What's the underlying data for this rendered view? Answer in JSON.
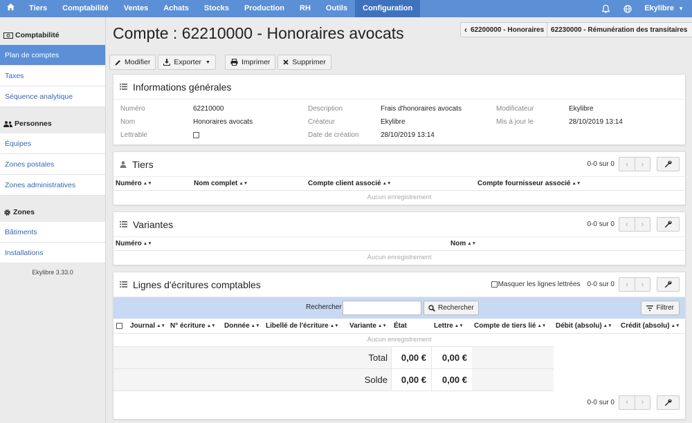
{
  "topnav": {
    "items": [
      "Tiers",
      "Comptabilité",
      "Ventes",
      "Achats",
      "Stocks",
      "Production",
      "RH",
      "Outils",
      "Configuration"
    ],
    "active": "Configuration",
    "user": "Ekylibre",
    "icons": [
      "home-icon",
      "bell-icon",
      "globe-icon",
      "caret-down-icon"
    ]
  },
  "sidebar": {
    "sections": [
      {
        "title": "Comptabilité",
        "icon": "money-icon",
        "items": [
          "Plan de comptes",
          "Taxes",
          "Séquence analytique"
        ]
      },
      {
        "title": "Personnes",
        "icon": "users-icon",
        "items": [
          "Équipes",
          "Zones postales",
          "Zones administratives"
        ]
      },
      {
        "title": "Zones",
        "icon": "gear-icon",
        "items": [
          "Bâtiments",
          "Installations"
        ]
      }
    ],
    "active_item": "Plan de comptes",
    "version": "Ekylibre 3.33.0"
  },
  "page": {
    "title": "Compte : 62210000 - Honoraires avocats",
    "prev_account": "62200000 - Honoraires",
    "next_account": "62230000 - Rémunération des transitaires"
  },
  "toolbar": {
    "modify": "Modifier",
    "export": "Exporter",
    "print": "Imprimer",
    "delete": "Supprimer"
  },
  "general": {
    "title": "Informations générales",
    "numero_label": "Numéro",
    "numero": "62210000",
    "nom_label": "Nom",
    "nom": "Honoraires avocats",
    "lettrable_label": "Lettrable",
    "lettrable": false,
    "description_label": "Description",
    "description": "Frais d'honoraires avocats",
    "createur_label": "Créateur",
    "createur": "Ekylibre",
    "date_creation_label": "Date de création",
    "date_creation": "28/10/2019 13:14",
    "modificateur_label": "Modificateur",
    "modificateur": "Ekylibre",
    "maj_label": "Mis à jour le",
    "maj": "28/10/2019 13:14"
  },
  "tiers": {
    "title": "Tiers",
    "count": "0-0 sur 0",
    "columns": [
      "Numéro",
      "Nom complet",
      "Compte client associé",
      "Compte fournisseur associé"
    ],
    "empty": "Aucun enregistrement"
  },
  "variantes": {
    "title": "Variantes",
    "count": "0-0 sur 0",
    "columns": [
      "Numéro",
      "Nom"
    ],
    "empty": "Aucun enregistrement"
  },
  "lignes": {
    "title": "Lignes d'écritures comptables",
    "mask_label": "Masquer les lignes lettrées",
    "mask_checked": false,
    "count": "0-0 sur 0",
    "search_label": "Rechercher",
    "search_value": "",
    "search_button": "Rechercher",
    "filter_button": "Filtrer",
    "columns": [
      "Journal",
      "N° écriture",
      "Donnée",
      "Libellé de l'écriture",
      "Variante",
      "État",
      "Lettre",
      "Compte de tiers lié",
      "Débit (absolu)",
      "Crédit (absolu)"
    ],
    "empty": "Aucun enregistrement",
    "total_label": "Total",
    "total_debit": "0,00 €",
    "total_credit": "0,00 €",
    "solde_label": "Solde",
    "solde_debit": "0,00 €",
    "solde_credit": "0,00 €",
    "footer_count": "0-0 sur 0"
  },
  "colors": {
    "nav": "#5b8fd6",
    "nav_active": "#3e72bd",
    "search_band": "#c7d9f3",
    "link": "#3366bb"
  }
}
